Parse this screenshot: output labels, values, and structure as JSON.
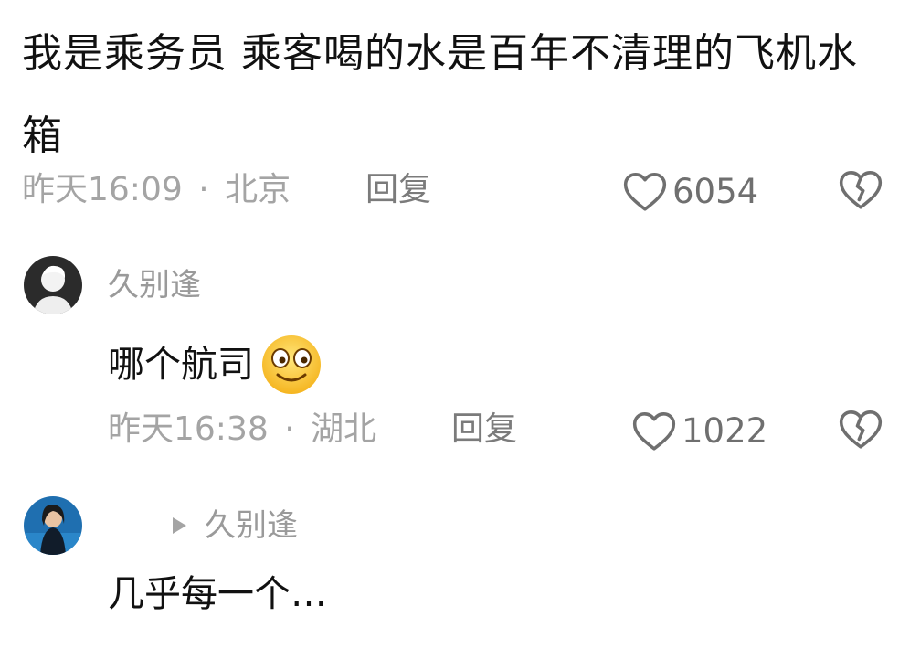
{
  "post": {
    "text": "我是乘务员 乘客喝的水是百年不清理的飞机水箱",
    "time": "昨天16:09",
    "separator": "·",
    "location": "北京",
    "reply_label": "回复",
    "likes": "6054"
  },
  "comments": [
    {
      "username": "久别逢",
      "text": "哪个航司",
      "emoji": "smiling-face-wide-eyes-icon",
      "time": "昨天16:38",
      "separator": "·",
      "location": "湖北",
      "reply_label": "回复",
      "likes": "1022"
    },
    {
      "reply_to": "久别逢",
      "text": "几乎每一个…"
    }
  ],
  "colors": {
    "text": "#111111",
    "meta": "#a4a4a4",
    "reply": "#7b7b7b",
    "icon": "#6f6f6f",
    "background": "#ffffff"
  }
}
